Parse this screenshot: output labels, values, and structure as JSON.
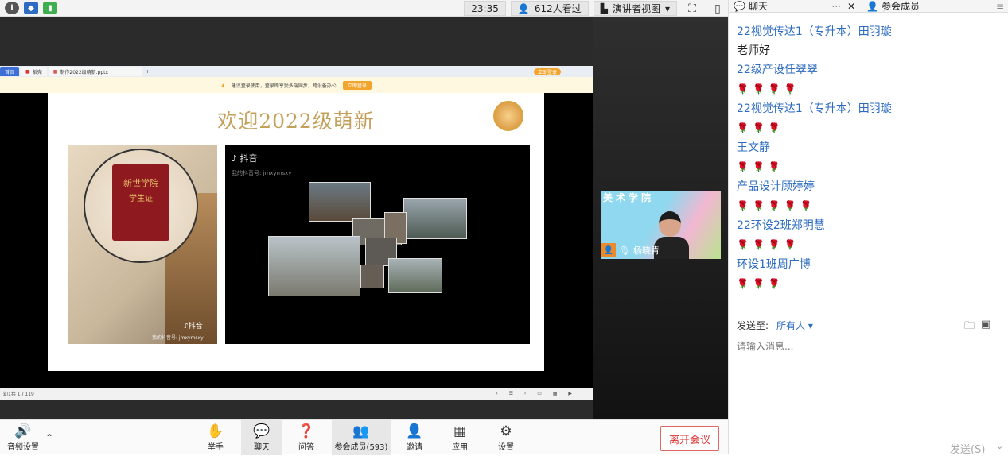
{
  "topbar": {
    "time": "23:35",
    "viewers": "612人看过",
    "view_mode": "演讲者视图"
  },
  "shared_screen": {
    "tab_home": "首页",
    "tab_doc1": "稻壳",
    "tab_file": "制作2022级萌新.pptx",
    "warn_text": "建议登录使用，登录即享受多端同步，跨设备办公",
    "warn_button": "立即登录",
    "login_badge": "立即登录",
    "slide_title": "欢迎2022级萌新",
    "book_text_1": "新世学院",
    "book_text_2": "学生证",
    "douyin_label": "抖音",
    "douyin_id": "我的抖音号: jmxymsxy",
    "douyin_watermark": "抖音",
    "douyin_watermark_id": "我的抖音号: jmxymsxy",
    "page_indicator": "幻1共 1 / 119"
  },
  "speaker": {
    "banner": "美术学院",
    "name": "杨晓青"
  },
  "toolbar": {
    "audio": "音频设置",
    "raise_hand": "举手",
    "chat": "聊天",
    "qa": "问答",
    "participants": "参会成员(593)",
    "invite": "邀请",
    "apps": "应用",
    "settings": "设置",
    "leave": "离开会议"
  },
  "chat_panel": {
    "tab_chat": "聊天",
    "tab_members": "参会成员",
    "messages": [
      {
        "sender": "22视觉传达1（专升本）田羽璇",
        "text": "老师好"
      },
      {
        "sender": "22级产设任翠翠",
        "roses": "🌹🌹🌹🌹"
      },
      {
        "sender": "22视觉传达1（专升本）田羽璇",
        "roses": "🌹🌹🌹"
      },
      {
        "sender": "王文静",
        "roses": "🌹🌹🌹"
      },
      {
        "sender": "产品设计顾婷婷",
        "roses": "🌹🌹🌹🌹🌹"
      },
      {
        "sender": "22环设2班郑明慧",
        "roses": "🌹🌹🌹🌹"
      },
      {
        "sender": "环设1班周广博",
        "roses": "🌹🌹🌹"
      }
    ],
    "send_to_label": "发送至:",
    "send_to_value": "所有人",
    "input_placeholder": "请输入消息...",
    "send_button": "发送(S)"
  }
}
